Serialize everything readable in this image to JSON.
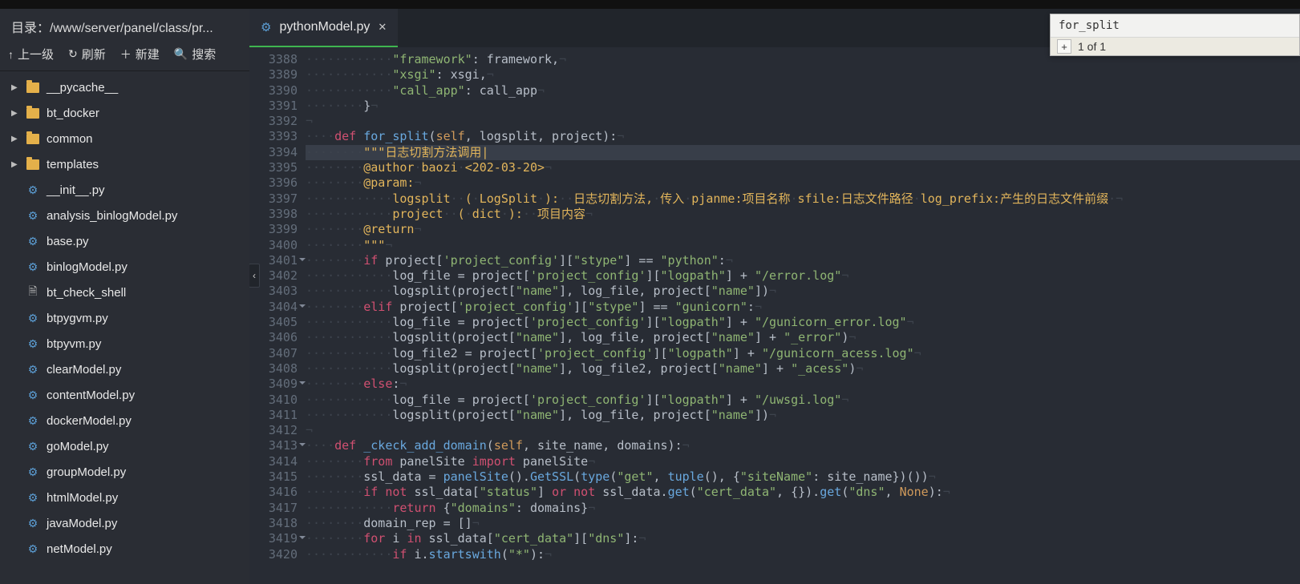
{
  "path_bar": {
    "label": "目录：",
    "path": "/www/server/panel/class/pr..."
  },
  "toolbar": {
    "up": "上一级",
    "refresh": "刷新",
    "new": "新建",
    "search": "搜索"
  },
  "tree": {
    "folders": [
      {
        "name": "__pycache__"
      },
      {
        "name": "bt_docker"
      },
      {
        "name": "common"
      },
      {
        "name": "templates"
      }
    ],
    "files": [
      {
        "name": "__init__.py",
        "icon": "python"
      },
      {
        "name": "analysis_binlogModel.py",
        "icon": "python"
      },
      {
        "name": "base.py",
        "icon": "python"
      },
      {
        "name": "binlogModel.py",
        "icon": "python"
      },
      {
        "name": "bt_check_shell",
        "icon": "file"
      },
      {
        "name": "btpygvm.py",
        "icon": "python"
      },
      {
        "name": "btpyvm.py",
        "icon": "python"
      },
      {
        "name": "clearModel.py",
        "icon": "python"
      },
      {
        "name": "contentModel.py",
        "icon": "python"
      },
      {
        "name": "dockerModel.py",
        "icon": "python"
      },
      {
        "name": "goModel.py",
        "icon": "python"
      },
      {
        "name": "groupModel.py",
        "icon": "python"
      },
      {
        "name": "htmlModel.py",
        "icon": "python"
      },
      {
        "name": "javaModel.py",
        "icon": "python"
      },
      {
        "name": "netModel.py",
        "icon": "python"
      }
    ]
  },
  "tab": {
    "title": "pythonModel.py"
  },
  "search": {
    "query": "for_split",
    "status": "1 of 1",
    "plus": "+"
  },
  "gutter": {
    "start": 3388,
    "end": 3420,
    "fold_lines": [
      3401,
      3404,
      3409,
      3413,
      3419
    ]
  },
  "code": {
    "highlighted_line_index": 6,
    "lines": [
      {
        "i": "············",
        "h": "<span class='s'>\"framework\"</span>: framework,<span class='nl'>¬</span>"
      },
      {
        "i": "············",
        "h": "<span class='s'>\"xsgi\"</span>: xsgi,<span class='nl'>¬</span>"
      },
      {
        "i": "············",
        "h": "<span class='s'>\"call_app\"</span>: call_app<span class='nl'>¬</span>"
      },
      {
        "i": "········",
        "h": "}<span class='nl'>¬</span>"
      },
      {
        "i": "",
        "h": "<span class='nl'>¬</span>"
      },
      {
        "i": "····",
        "h": "<span class='k'>def</span> <span class='fn'>for_split</span>(<span class='self'>self</span>, logsplit, project):<span class='nl'>¬</span>"
      },
      {
        "i": "········",
        "h": "<span class='sd'>\"\"\"日志切割方法调用|</span>"
      },
      {
        "i": "········",
        "h": "<span class='sd'>@author</span><span class='ws'>·</span><span class='sd'>baozi</span><span class='ws'>·</span><span class='sd'>&lt;202-03-20&gt;</span><span class='nl'>¬</span>"
      },
      {
        "i": "········",
        "h": "<span class='sd'>@param:</span><span class='nl'>¬</span>"
      },
      {
        "i": "············",
        "h": "<span class='sd'>logsplit</span><span class='ws'>··</span><span class='sd'>(</span><span class='ws'>·</span><span class='sd'>LogSplit</span><span class='ws'>·</span><span class='sd'>):</span><span class='ws'>··</span><span class='sd'>日志切割方法,</span><span class='ws'>·</span><span class='sd'>传入</span><span class='ws'>·</span><span class='sd'>pjanme:项目名称</span><span class='ws'>·</span><span class='sd'>sfile:日志文件路径</span><span class='ws'>·</span><span class='sd'>log_prefix:产生的日志文件前缀</span><span class='ws'>·</span><span class='nl'>¬</span>"
      },
      {
        "i": "············",
        "h": "<span class='sd'>project</span><span class='ws'>··</span><span class='sd'>(</span><span class='ws'>·</span><span class='sd'>dict</span><span class='ws'>·</span><span class='sd'>):</span><span class='ws'>··</span><span class='sd'>项目内容</span><span class='nl'>¬</span>"
      },
      {
        "i": "········",
        "h": "<span class='sd'>@return</span><span class='nl'>¬</span>"
      },
      {
        "i": "········",
        "h": "<span class='sd'>\"\"\"</span><span class='nl'>¬</span>"
      },
      {
        "i": "········",
        "h": "<span class='k'>if</span> project[<span class='s'>'project_config'</span>][<span class='s'>\"stype\"</span>] == <span class='s'>\"python\"</span>:<span class='nl'>¬</span>"
      },
      {
        "i": "············",
        "h": "log_file = project[<span class='s'>'project_config'</span>][<span class='s'>\"logpath\"</span>] + <span class='s'>\"/error.log\"</span><span class='nl'>¬</span>"
      },
      {
        "i": "············",
        "h": "logsplit(project[<span class='s'>\"name\"</span>], log_file, project[<span class='s'>\"name\"</span>])<span class='nl'>¬</span>"
      },
      {
        "i": "········",
        "h": "<span class='k'>elif</span> project[<span class='s'>'project_config'</span>][<span class='s'>\"stype\"</span>] == <span class='s'>\"gunicorn\"</span>:<span class='nl'>¬</span>"
      },
      {
        "i": "············",
        "h": "log_file = project[<span class='s'>'project_config'</span>][<span class='s'>\"logpath\"</span>] + <span class='s'>\"/gunicorn_error.log\"</span><span class='nl'>¬</span>"
      },
      {
        "i": "············",
        "h": "logsplit(project[<span class='s'>\"name\"</span>], log_file, project[<span class='s'>\"name\"</span>] + <span class='s'>\"_error\"</span>)<span class='nl'>¬</span>"
      },
      {
        "i": "············",
        "h": "log_file2 = project[<span class='s'>'project_config'</span>][<span class='s'>\"logpath\"</span>] + <span class='s'>\"/gunicorn_acess.log\"</span><span class='nl'>¬</span>"
      },
      {
        "i": "············",
        "h": "logsplit(project[<span class='s'>\"name\"</span>], log_file2, project[<span class='s'>\"name\"</span>] + <span class='s'>\"_acess\"</span>)<span class='nl'>¬</span>"
      },
      {
        "i": "········",
        "h": "<span class='k'>else</span>:<span class='nl'>¬</span>"
      },
      {
        "i": "············",
        "h": "log_file = project[<span class='s'>'project_config'</span>][<span class='s'>\"logpath\"</span>] + <span class='s'>\"/uwsgi.log\"</span><span class='nl'>¬</span>"
      },
      {
        "i": "············",
        "h": "logsplit(project[<span class='s'>\"name\"</span>], log_file, project[<span class='s'>\"name\"</span>])<span class='nl'>¬</span>"
      },
      {
        "i": "",
        "h": "<span class='nl'>¬</span>"
      },
      {
        "i": "····",
        "h": "<span class='k'>def</span> <span class='fn'>_ckeck_add_domain</span>(<span class='self'>self</span>, site_name, domains):<span class='nl'>¬</span>"
      },
      {
        "i": "········",
        "h": "<span class='k'>from</span> panelSite <span class='k'>import</span> panelSite<span class='nl'>¬</span>"
      },
      {
        "i": "········",
        "h": "ssl_data = <span class='fn'>panelSite</span>().<span class='fn'>GetSSL</span>(<span class='fn'>type</span>(<span class='s'>\"get\"</span>, <span class='fn'>tuple</span>(), {<span class='s'>\"siteName\"</span>: site_name})())<span class='nl'>¬</span>"
      },
      {
        "i": "········",
        "h": "<span class='k'>if</span> <span class='k'>not</span> ssl_data[<span class='s'>\"status\"</span>] <span class='k'>or</span> <span class='k'>not</span> ssl_data.<span class='fn'>get</span>(<span class='s'>\"cert_data\"</span>, {}).<span class='fn'>get</span>(<span class='s'>\"dns\"</span>, <span class='n'>None</span>):<span class='nl'>¬</span>"
      },
      {
        "i": "············",
        "h": "<span class='k'>return</span> {<span class='s'>\"domains\"</span>: domains}<span class='nl'>¬</span>"
      },
      {
        "i": "········",
        "h": "domain_rep = []<span class='nl'>¬</span>"
      },
      {
        "i": "········",
        "h": "<span class='k'>for</span> i <span class='k'>in</span> ssl_data[<span class='s'>\"cert_data\"</span>][<span class='s'>\"dns\"</span>]:<span class='nl'>¬</span>"
      },
      {
        "i": "············",
        "h": "<span class='k'>if</span> i.<span class='fn'>startswith</span>(<span class='s'>\"*\"</span>):<span class='nl'>¬</span>"
      }
    ]
  }
}
